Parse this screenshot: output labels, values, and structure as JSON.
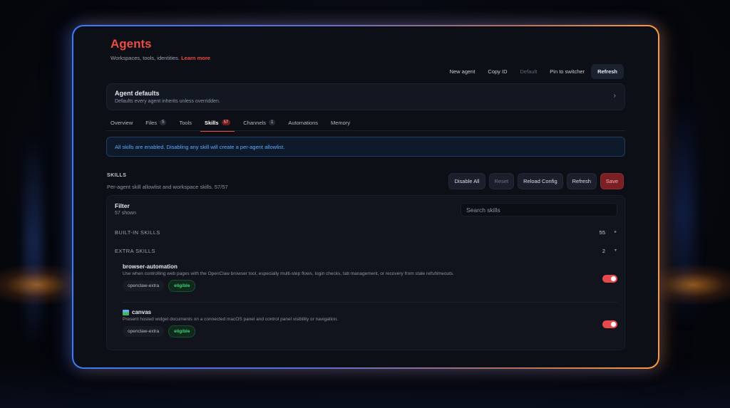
{
  "header": {
    "title": "Agents",
    "subtitle": "Workspaces, tools, identities.",
    "learn_more": "Learn more"
  },
  "toolbar": {
    "new_agent": "New agent",
    "copy_id": "Copy ID",
    "default": "Default",
    "pin": "Pin to switcher",
    "refresh": "Refresh"
  },
  "defaults_card": {
    "title": "Agent defaults",
    "subtitle": "Defaults every agent inherits unless overridden.",
    "chevron": "›"
  },
  "tabs": [
    {
      "label": "Overview",
      "count": ""
    },
    {
      "label": "Files",
      "count": "5"
    },
    {
      "label": "Tools",
      "count": ""
    },
    {
      "label": "Skills",
      "count": "57"
    },
    {
      "label": "Channels",
      "count": "1"
    },
    {
      "label": "Automations",
      "count": ""
    },
    {
      "label": "Memory",
      "count": ""
    }
  ],
  "active_tab": "Skills",
  "info_banner": "All skills are enabled. Disabling any skill will create a per-agent allowlist.",
  "skills_section": {
    "title": "SKILLS",
    "subtitle": "Per-agent skill allowlist and workspace skills. 57/57",
    "actions": {
      "disable_all": "Disable All",
      "reset": "Reset",
      "reload": "Reload Config",
      "refresh": "Refresh",
      "save": "Save"
    }
  },
  "filter": {
    "title": "Filter",
    "shown": "57 shown",
    "placeholder": "Search skills"
  },
  "groups": {
    "builtin": {
      "label": "BUILT-IN SKILLS",
      "count": "55",
      "icon": "▸"
    },
    "extra": {
      "label": "EXTRA SKILLS",
      "count": "2",
      "icon": "▾"
    }
  },
  "skills": [
    {
      "name": "browser-automation",
      "icon": "",
      "description": "Use when controlling web pages with the OpenClaw browser tool, especially multi-step flows, login checks, tab management, or recovery from stale refs/timeouts.",
      "source": "openclaw-extra",
      "status": "eligible",
      "enabled": true
    },
    {
      "name": "canvas",
      "icon": "image-icon",
      "description": "Present hosted widget documents on a connected macOS panel and control panel visibility or navigation.",
      "source": "openclaw-extra",
      "status": "eligible",
      "enabled": true
    }
  ],
  "colors": {
    "accent": "#ef4a44",
    "info": "#5fa8ff",
    "eligible": "#3ad37a",
    "frame_left": "#3a7bff",
    "frame_right": "#ff9a3c"
  }
}
